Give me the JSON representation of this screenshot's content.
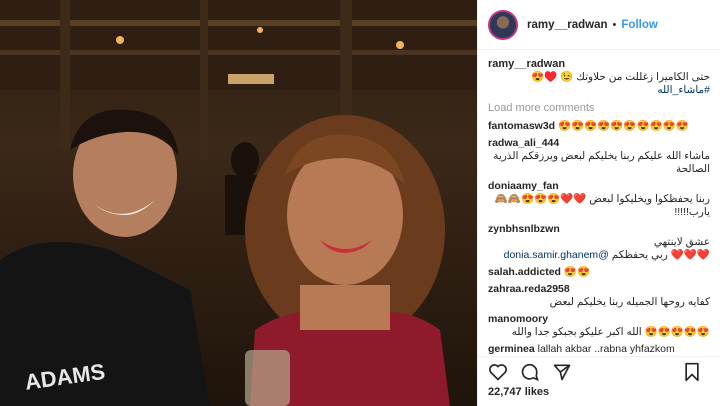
{
  "header": {
    "username": "ramy__radwan",
    "separator": "•",
    "follow_label": "Follow"
  },
  "caption": {
    "username": "ramy__radwan",
    "text": "حتى الكاميرا زغللت من حلاوتك 😉 ♥️😍",
    "hashtag": "#ماشاء_الله"
  },
  "load_more_label": "Load more comments",
  "comments": [
    {
      "user": "fantomasw3d",
      "text": "😍😍😍😍😍😍😍😍😍😍",
      "rtl": false
    },
    {
      "user": "radwa_ali_444",
      "text": "ماشاء الله عليكم ربنا يخليكم لبعض ويرزقكم الذرية الصالحة",
      "rtl": true
    },
    {
      "user": "doniaamy_fan",
      "text": "ربنا يحفظكوا ويخليكوا لبعض ❤️❤️😍😍😍🙈🙈 يارب!!!!!",
      "rtl": true
    },
    {
      "user": "zynbhsnlbzwn",
      "text": "عشق لاينتهي",
      "mention": "@donia.samir.ghanem",
      "tail": "❤️❤️❤️ ربي يحفظكم",
      "rtl": true
    },
    {
      "user": "salah.addicted",
      "text": "😍😍",
      "rtl": false
    },
    {
      "user": "zahraa.reda2958",
      "text": "كفايه روحها الجميله ربنا يخليكم لبعض",
      "rtl": true
    },
    {
      "user": "manomoory",
      "text": "😍😍😍😍😍 الله اكبر عليكو بجبكو جدا والله",
      "rtl": true
    },
    {
      "user": "germinea",
      "text": "lallah akbar ..rabna yhfazkom",
      "rtl": false
    }
  ],
  "icons": {
    "like": "heart-icon",
    "comment": "comment-icon",
    "share": "share-icon",
    "save": "bookmark-icon"
  },
  "likes_text": "22,747 likes",
  "colors": {
    "accent": "#3897f0",
    "hashtag": "#003569",
    "muted": "#999999"
  }
}
